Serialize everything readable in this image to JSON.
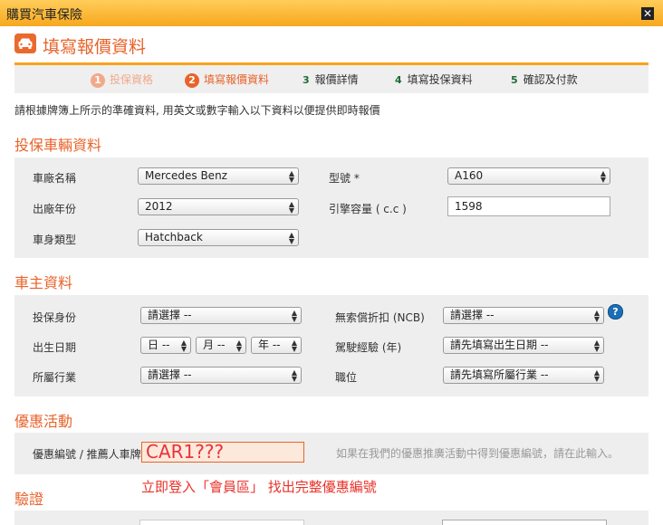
{
  "window": {
    "title": "購買汽車保險"
  },
  "header": {
    "title": "填寫報價資料"
  },
  "steps": [
    {
      "num": "1",
      "label": "投保資格"
    },
    {
      "num": "2",
      "label": "填寫報價資料"
    },
    {
      "num": "3",
      "label": "報價詳情"
    },
    {
      "num": "4",
      "label": "填寫投保資料"
    },
    {
      "num": "5",
      "label": "確認及付款"
    }
  ],
  "intro": "請根據牌簿上所示的準確資料, 用英文或數字輸入以下資料以便提供即時報價",
  "vehicle": {
    "title": "投保車輛資料",
    "make_label": "車廠名稱",
    "make_value": "Mercedes Benz",
    "model_label": "型號 *",
    "model_value": "A160",
    "year_label": "出廠年份",
    "year_value": "2012",
    "cc_label": "引擎容量 ( c.c )",
    "cc_value": "1598",
    "body_label": "車身類型",
    "body_value": "Hatchback"
  },
  "owner": {
    "title": "車主資料",
    "identity_label": "投保身份",
    "identity_value": "請選擇 --",
    "ncb_label": "無索償折扣 (NCB)",
    "ncb_value": "請選擇 --",
    "dob_label": "出生日期",
    "dob_day": "日 --",
    "dob_month": "月 --",
    "dob_year": "年 --",
    "exp_label": "駕駛經驗 (年)",
    "exp_value": "請先填寫出生日期 --",
    "industry_label": "所屬行業",
    "industry_value": "請選擇 --",
    "position_label": "職位",
    "position_value": "請先填寫所屬行業 --"
  },
  "promo": {
    "title": "優惠活動",
    "code_label": "優惠編號 / 推薦人車牌",
    "code_value": "CAR1???",
    "hint": "如果在我們的優惠推廣活動中得到優惠編號，請在此輸入。",
    "link": "立即登入「會員區」 找出完整優惠編號"
  },
  "verify": {
    "title": "驗證"
  },
  "icons": {
    "close": "close-icon",
    "car": "car-icon",
    "help": "help-icon",
    "arrows": "select-arrows-icon"
  },
  "colors": {
    "accent": "#e8632a",
    "titlebar": "#f7a81d",
    "panel": "#eeeeee"
  }
}
